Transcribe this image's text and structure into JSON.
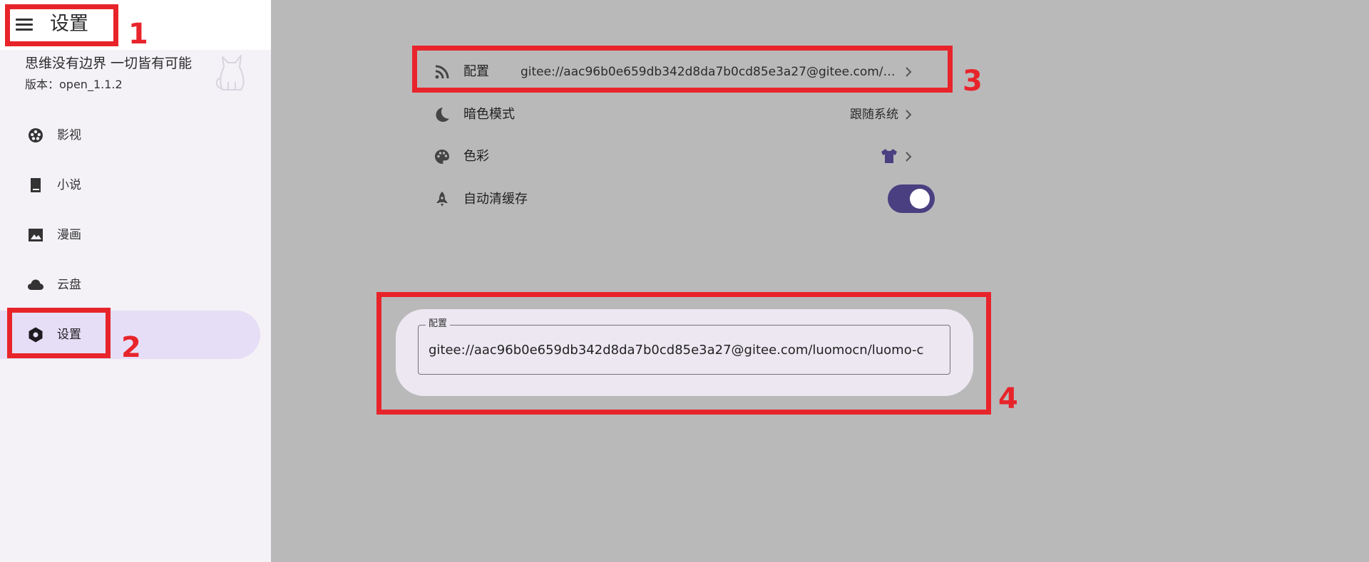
{
  "header": {
    "title": "设置"
  },
  "sidebar": {
    "slogan": "思维没有边界 一切皆有可能",
    "version_label": "版本：",
    "version": "open_1.1.2",
    "items": [
      {
        "label": "影视",
        "icon": "film-reel-icon"
      },
      {
        "label": "小说",
        "icon": "book-icon"
      },
      {
        "label": "漫画",
        "icon": "image-icon"
      },
      {
        "label": "云盘",
        "icon": "cloud-icon"
      },
      {
        "label": "设置",
        "icon": "settings-hexagon-icon",
        "active": true
      }
    ]
  },
  "settings": {
    "config": {
      "label": "配置",
      "value": "gitee://aac96b0e659db342d8da7b0cd85e3a27@gitee.com/luo...",
      "icon": "rss-icon"
    },
    "dark_mode": {
      "label": "暗色模式",
      "value": "跟随系统",
      "icon": "moon-icon"
    },
    "color": {
      "label": "色彩",
      "icon": "palette-icon",
      "swatch_icon": "tshirt-icon",
      "swatch_color": "#4a3f80"
    },
    "auto_clear_cache": {
      "label": "自动清缓存",
      "icon": "rocket-icon",
      "enabled": true
    }
  },
  "config_dialog": {
    "field_label": "配置",
    "value": "gitee://aac96b0e659db342d8da7b0cd85e3a27@gitee.com/luomocn/luomo-c"
  },
  "annotations": [
    "1",
    "2",
    "3",
    "4"
  ],
  "colors": {
    "accent": "#4a3f80",
    "active_nav_bg": "#e6def6",
    "annotation_red": "#e8242b",
    "backdrop": "#bab9ba"
  }
}
